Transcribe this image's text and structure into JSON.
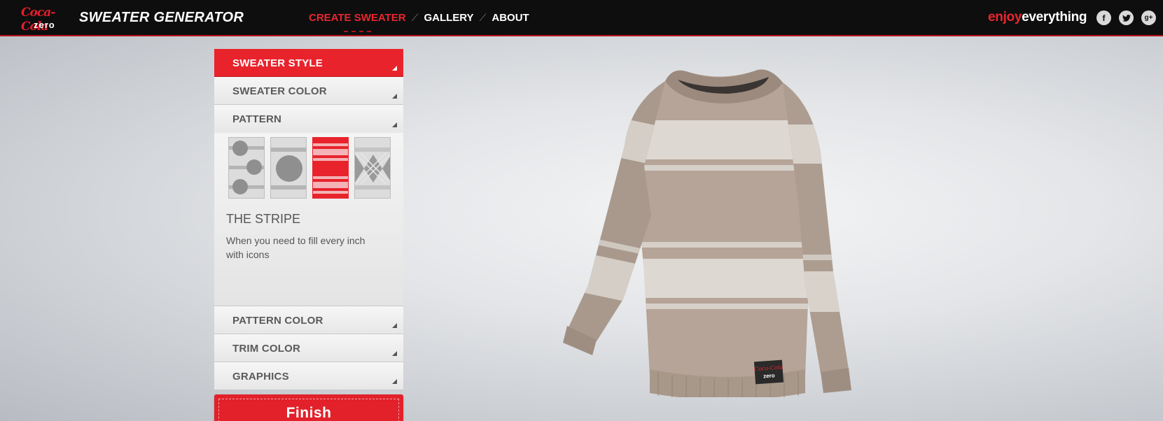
{
  "header": {
    "logo_script": "Coca-Cola",
    "logo_sub": "zero",
    "title": "SWEATER GENERATOR",
    "nav": [
      {
        "label": "CREATE SWEATER",
        "active": true
      },
      {
        "label": "GALLERY",
        "active": false
      },
      {
        "label": "ABOUT",
        "active": false
      }
    ],
    "nav_separator": "⟋",
    "tagline_part1": "enjoy",
    "tagline_part2": "everything",
    "social": [
      {
        "icon": "facebook-icon",
        "glyph": "f"
      },
      {
        "icon": "twitter-icon",
        "glyph": "t"
      },
      {
        "icon": "google-plus-icon",
        "glyph": "g+"
      }
    ]
  },
  "panel": {
    "sections": [
      {
        "label": "SWEATER STYLE",
        "active": true
      },
      {
        "label": "SWEATER COLOR",
        "active": false
      },
      {
        "label": "PATTERN",
        "active": false,
        "expanded": true
      },
      {
        "label": "PATTERN COLOR",
        "active": false
      },
      {
        "label": "TRIM COLOR",
        "active": false
      },
      {
        "label": "GRAPHICS",
        "active": false
      }
    ],
    "pattern": {
      "options": [
        "dots",
        "circle",
        "stripe",
        "argyle"
      ],
      "selected": "stripe",
      "title": "THE STRIPE",
      "description": "When you need to fill every inch with icons"
    },
    "finish_label": "Finish"
  },
  "sweater": {
    "label_script": "Coca-Cola",
    "label_sub": "zero"
  },
  "colors": {
    "brand_red": "#e8232c",
    "topbar": "#0e0e0e",
    "sweater_base": "#b5a497",
    "sweater_stripe": "#ddd8d2"
  }
}
